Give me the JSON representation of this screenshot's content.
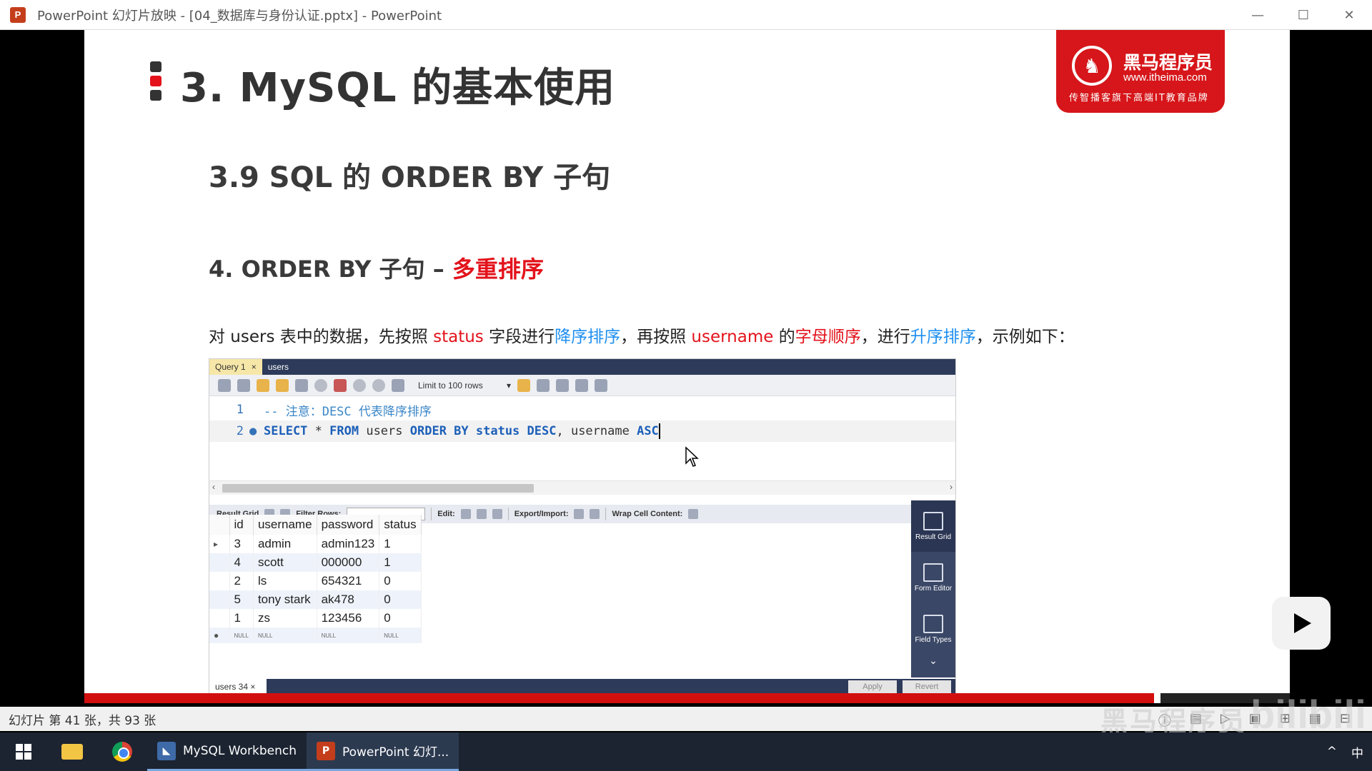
{
  "window": {
    "title": "PowerPoint 幻灯片放映 - [04_数据库与身份认证.pptx] - PowerPoint",
    "app_icon_letter": "P",
    "controls": [
      "—",
      "☐",
      "✕"
    ]
  },
  "slide": {
    "heading": "3. MySQL 的基本使用",
    "subheading": "3.9 SQL 的 ORDER BY 子句",
    "point_prefix": "4. ORDER BY 子句 – ",
    "point_highlight": "多重排序",
    "desc": {
      "p1": "对 users 表中的数据，先按照 ",
      "k1": "status",
      "p2": " 字段进行",
      "k2": "降序排序",
      "p3": "，再按照 ",
      "k3": "username",
      "p4": " 的",
      "k4": "字母顺序",
      "p5": "，进行",
      "k5": "升序排序",
      "p6": "，示例如下："
    },
    "logo": {
      "name": "黑马程序员",
      "url": "www.itheima.com",
      "slogan": "传智播客旗下高端IT教育品牌"
    },
    "colors": {
      "accent_red": "#e3121b",
      "accent_blue": "#1e8ff0"
    }
  },
  "workbench": {
    "tabs": [
      {
        "label": "Query 1",
        "close": "×"
      },
      {
        "label": "users"
      }
    ],
    "limit": "Limit to 100 rows",
    "editor": {
      "line1_no": "1",
      "line1": "-- 注意：DESC 代表降序排序",
      "line2_no": "2",
      "line2_dot": "●",
      "kw_select": "SELECT",
      "star": " * ",
      "kw_from": "FROM",
      "tbl": " users ",
      "kw_order": "ORDER BY",
      "col1": " status ",
      "kw_desc": "DESC",
      "comma": ", username ",
      "kw_asc": "ASC"
    },
    "result_toolbar": {
      "result_grid": "Result Grid",
      "filter_rows": "Filter Rows:",
      "edit": "Edit:",
      "export_import": "Export/Import:",
      "wrap": "Wrap Cell Content:"
    },
    "columns": [
      "id",
      "username",
      "password",
      "status"
    ],
    "rows": [
      [
        "3",
        "admin",
        "admin123",
        "1"
      ],
      [
        "4",
        "scott",
        "000000",
        "1"
      ],
      [
        "2",
        "ls",
        "654321",
        "0"
      ],
      [
        "5",
        "tony stark",
        "ak478",
        "0"
      ],
      [
        "1",
        "zs",
        "123456",
        "0"
      ]
    ],
    "null_label": "NULL",
    "side_panel": [
      "Result Grid",
      "Form Editor",
      "Field Types"
    ],
    "bottom_tab": "users 34",
    "bottom_close": "×",
    "apply": "Apply",
    "revert": "Revert"
  },
  "statusbar": {
    "text": "幻灯片 第 41 张，共 93 张"
  },
  "watermark": {
    "text": "黑马程序员",
    "site": "bilibili"
  },
  "taskbar": {
    "apps": [
      {
        "label": "MySQL Workbench",
        "icon_color": "#3e6aa8"
      },
      {
        "label": "PowerPoint 幻灯...",
        "icon_color": "#c43e1c"
      }
    ],
    "ime": "中",
    "tray_arrow": "^"
  }
}
